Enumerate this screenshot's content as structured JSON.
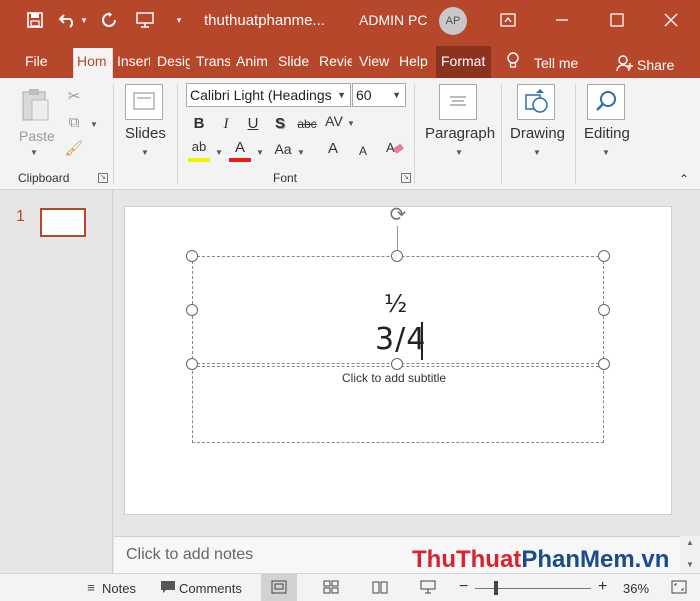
{
  "titlebar": {
    "file_name": "thuthuatphanme...",
    "user_name": "ADMIN PC",
    "avatar_initials": "AP"
  },
  "tabs": [
    "File",
    "Hom",
    "Insert",
    "Desig",
    "Trans",
    "Anim",
    "Slide",
    "Revie",
    "View",
    "Help",
    "Format"
  ],
  "tell_me": "Tell me",
  "share": "Share",
  "ribbon": {
    "clipboard": {
      "paste": "Paste",
      "label": "Clipboard"
    },
    "slides": {
      "label": "Slides"
    },
    "font": {
      "name": "Calibri Light (Headings",
      "size": "60",
      "label": "Font",
      "bold": "B",
      "italic": "I",
      "underline": "U",
      "shadow": "S",
      "strike": "abc",
      "spacing": "AV",
      "change_case": "Aa",
      "grow": "A",
      "shrink": "A",
      "highlight": "ab",
      "font_color": "A"
    },
    "paragraph": "Paragraph",
    "drawing": "Drawing",
    "editing": "Editing"
  },
  "thumbnail": {
    "slide_number": "1"
  },
  "slide": {
    "title_line1": "½",
    "title_line2": "3/4",
    "subtitle_placeholder": "Click to add subtitle"
  },
  "notes_placeholder": "Click to add notes",
  "statusbar": {
    "notes": "Notes",
    "comments": "Comments",
    "zoom_minus": "−",
    "zoom_plus": "+",
    "zoom": "36%",
    "zoom_fraction": 0.18
  },
  "watermark": {
    "part1": "ThuThuat",
    "part2": "PhanMem",
    "part3": ".vn"
  },
  "colors": {
    "accent": "#b7472a",
    "format_tab": "#8c3320"
  }
}
